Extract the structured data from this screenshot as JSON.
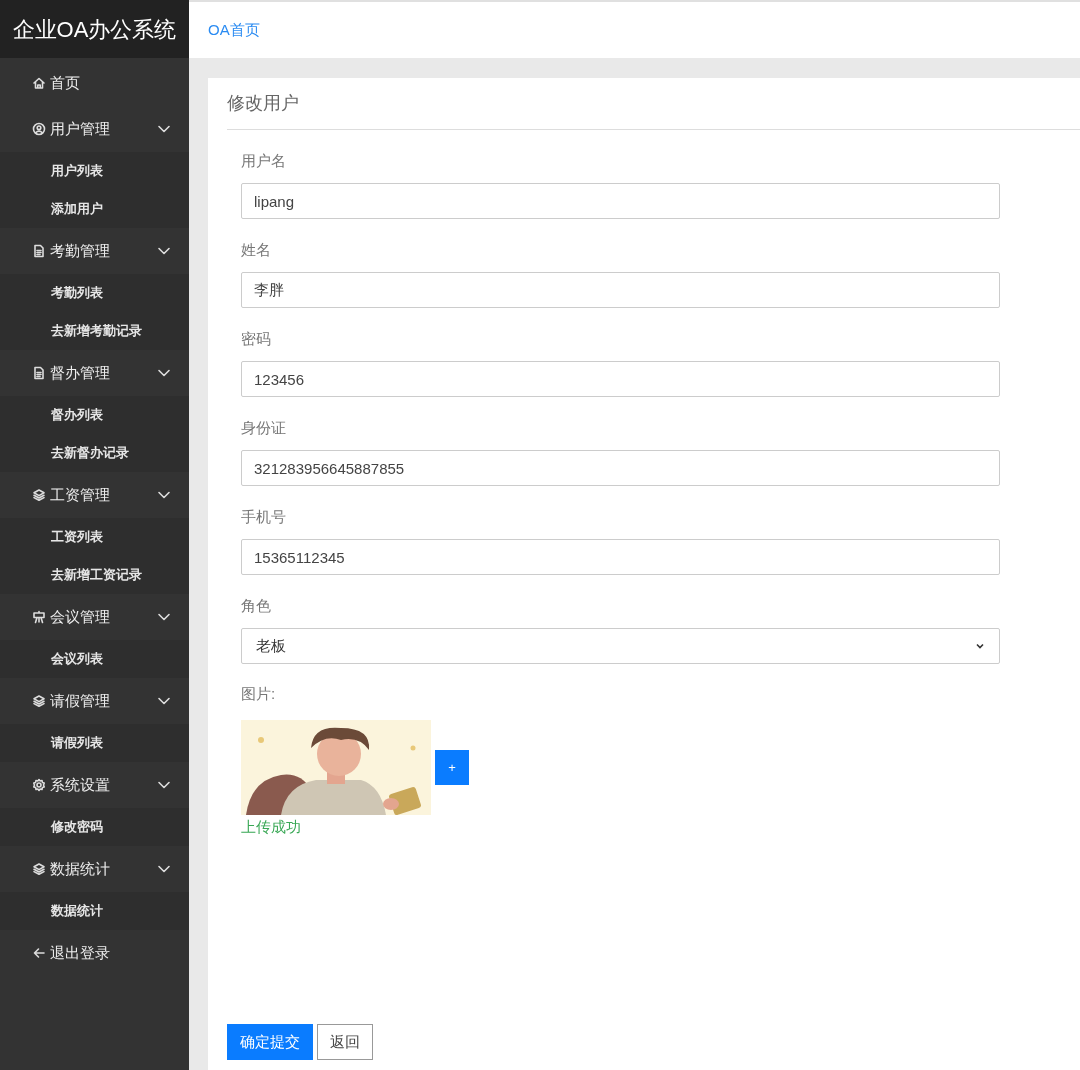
{
  "app_title": "企业OA办公系统",
  "breadcrumb": "OA首页",
  "sidebar": {
    "items": [
      {
        "kind": "link",
        "label": "首页"
      },
      {
        "kind": "group",
        "label": "用户管理",
        "expanded": true,
        "children": [
          {
            "label": "用户列表"
          },
          {
            "label": "添加用户"
          }
        ]
      },
      {
        "kind": "group",
        "label": "考勤管理",
        "expanded": true,
        "children": [
          {
            "label": "考勤列表"
          },
          {
            "label": "去新增考勤记录"
          }
        ]
      },
      {
        "kind": "group",
        "label": "督办管理",
        "expanded": true,
        "children": [
          {
            "label": "督办列表"
          },
          {
            "label": "去新督办记录"
          }
        ]
      },
      {
        "kind": "group",
        "label": "工资管理",
        "expanded": true,
        "children": [
          {
            "label": "工资列表"
          },
          {
            "label": "去新增工资记录"
          }
        ]
      },
      {
        "kind": "group",
        "label": "会议管理",
        "expanded": true,
        "children": [
          {
            "label": "会议列表"
          }
        ]
      },
      {
        "kind": "group",
        "label": "请假管理",
        "expanded": true,
        "children": [
          {
            "label": "请假列表"
          }
        ]
      },
      {
        "kind": "group",
        "label": "系统设置",
        "expanded": true,
        "children": [
          {
            "label": "修改密码"
          }
        ]
      },
      {
        "kind": "group",
        "label": "数据统计",
        "expanded": true,
        "children": [
          {
            "label": "数据统计"
          }
        ]
      },
      {
        "kind": "link",
        "label": "退出登录"
      }
    ]
  },
  "form": {
    "title": "修改用户",
    "fields": [
      {
        "kind": "text",
        "label": "用户名",
        "value": "lipang"
      },
      {
        "kind": "text",
        "label": "姓名",
        "value": "李胖"
      },
      {
        "kind": "text",
        "label": "密码",
        "value": "123456"
      },
      {
        "kind": "text",
        "label": "身份证",
        "value": "321283956645887855"
      },
      {
        "kind": "text",
        "label": "手机号",
        "value": "15365112345"
      },
      {
        "kind": "select",
        "label": "角色",
        "value": "老板"
      }
    ],
    "image_label": "图片:",
    "upload_button": "+",
    "upload_status": "上传成功",
    "buttons": [
      {
        "kind": "primary",
        "label": "确定提交"
      },
      {
        "kind": "secondary",
        "label": "返回"
      }
    ]
  }
}
